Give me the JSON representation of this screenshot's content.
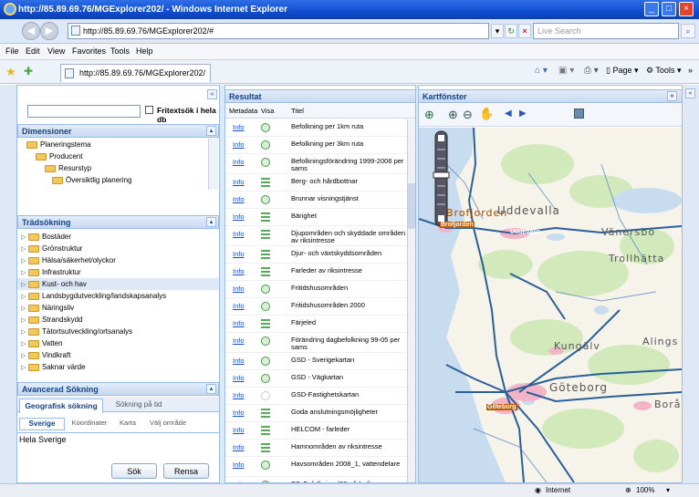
{
  "window": {
    "title": "http://85.89.69.76/MGExplorer202/ - Windows Internet Explorer"
  },
  "addressbar": {
    "url": "http://85.89.69.76/MGExplorer202/#",
    "search_placeholder": "Live Search"
  },
  "menu": [
    "File",
    "Edit",
    "View",
    "Favorites",
    "Tools",
    "Help"
  ],
  "tab": {
    "label": "http://85.89.69.76/MGExplorer202/"
  },
  "toolbar": {
    "page_label": "Page",
    "tools_label": "Tools"
  },
  "left": {
    "freetext_label": "Fritextsök i hela db",
    "dimensions": {
      "title": "Dimensioner",
      "items": [
        "Planeringstema",
        "Producent",
        "Resurstyp",
        "Översiktlig planering"
      ]
    },
    "tree": {
      "title": "Trädsökning",
      "items": [
        "Bostäder",
        "Grönstruktur",
        "Hälsa/säkerhet/olyckor",
        "Infrastruktur",
        "Kust- och hav",
        "Landsbygdutveckling/landskapsanalys",
        "Näringsliv",
        "Strandskydd",
        "Tätortsutveckling/ortsanalys",
        "Vatten",
        "Vindkraft",
        "Saknar värde"
      ]
    },
    "advanced": {
      "title": "Avancerad Sökning",
      "tabs": [
        "Geografisk sökning",
        "Sökning på tid"
      ],
      "subtabs": [
        "Sverige",
        "Koordinater",
        "Karta",
        "Välj område"
      ],
      "area_value": "Hela Sverige",
      "search_button": "Sök",
      "clear_button": "Rensa"
    }
  },
  "results": {
    "title": "Resultat",
    "columns": [
      "Metadata",
      "Visa",
      "Titel"
    ],
    "rows": [
      {
        "meta": "Info",
        "icon": "circle",
        "title": "Befolkning per 1km ruta"
      },
      {
        "meta": "Info",
        "icon": "circle",
        "title": "Befolkning per 3km ruta"
      },
      {
        "meta": "Info",
        "icon": "circle",
        "title": "Befolkningsförändring 1999-2006 per sams"
      },
      {
        "meta": "Info",
        "icon": "lines",
        "title": "Berg- och hårdbottnar"
      },
      {
        "meta": "Info",
        "icon": "circle",
        "title": "Brunnar visningstjänst"
      },
      {
        "meta": "Info",
        "icon": "lines",
        "title": "Bärighet"
      },
      {
        "meta": "Info",
        "icon": "lines",
        "title": "Djupområden och skyddade områden av riksintresse"
      },
      {
        "meta": "Info",
        "icon": "lines",
        "title": "Djur- och växtskyddsområden"
      },
      {
        "meta": "Info",
        "icon": "lines",
        "title": "Farleder av riksintresse"
      },
      {
        "meta": "Info",
        "icon": "circle",
        "title": "Fritidshusområden"
      },
      {
        "meta": "Info",
        "icon": "circle",
        "title": "Fritidshusområden 2000"
      },
      {
        "meta": "Info",
        "icon": "lines",
        "title": "Färjeled"
      },
      {
        "meta": "Info",
        "icon": "circle",
        "title": "Förändring dagbefolkning 99-05 per sams"
      },
      {
        "meta": "Info",
        "icon": "circle",
        "title": "GSD - Sverigekartan"
      },
      {
        "meta": "Info",
        "icon": "circle",
        "title": "GSD - Vägkartan"
      },
      {
        "meta": "Info",
        "icon": "blank",
        "title": "GSD-Fastighetskartan"
      },
      {
        "meta": "Info",
        "icon": "lines",
        "title": "Goda anslutningsmöjligheter"
      },
      {
        "meta": "Info",
        "icon": "lines",
        "title": "HELCOM - farleder"
      },
      {
        "meta": "Info",
        "icon": "lines",
        "title": "Hamnområden av riksintresse"
      },
      {
        "meta": "Info",
        "icon": "circle",
        "title": "Havsområden 2008_1, vattendelare"
      },
      {
        "meta": "Info",
        "icon": "circle",
        "title": "B7: Befolkning (20+ år) efter"
      }
    ]
  },
  "map": {
    "title": "Kartfönster",
    "labels": [
      "Brofjorden",
      "Uddevalla",
      "Vänersbo",
      "Trollhätta",
      "Kungälv",
      "Alings",
      "Göteborg",
      "Borå",
      "Brofjorden",
      "Uddevalla",
      "Göteborg"
    ]
  },
  "status": {
    "zone": "Internet",
    "zoom": "100%"
  }
}
